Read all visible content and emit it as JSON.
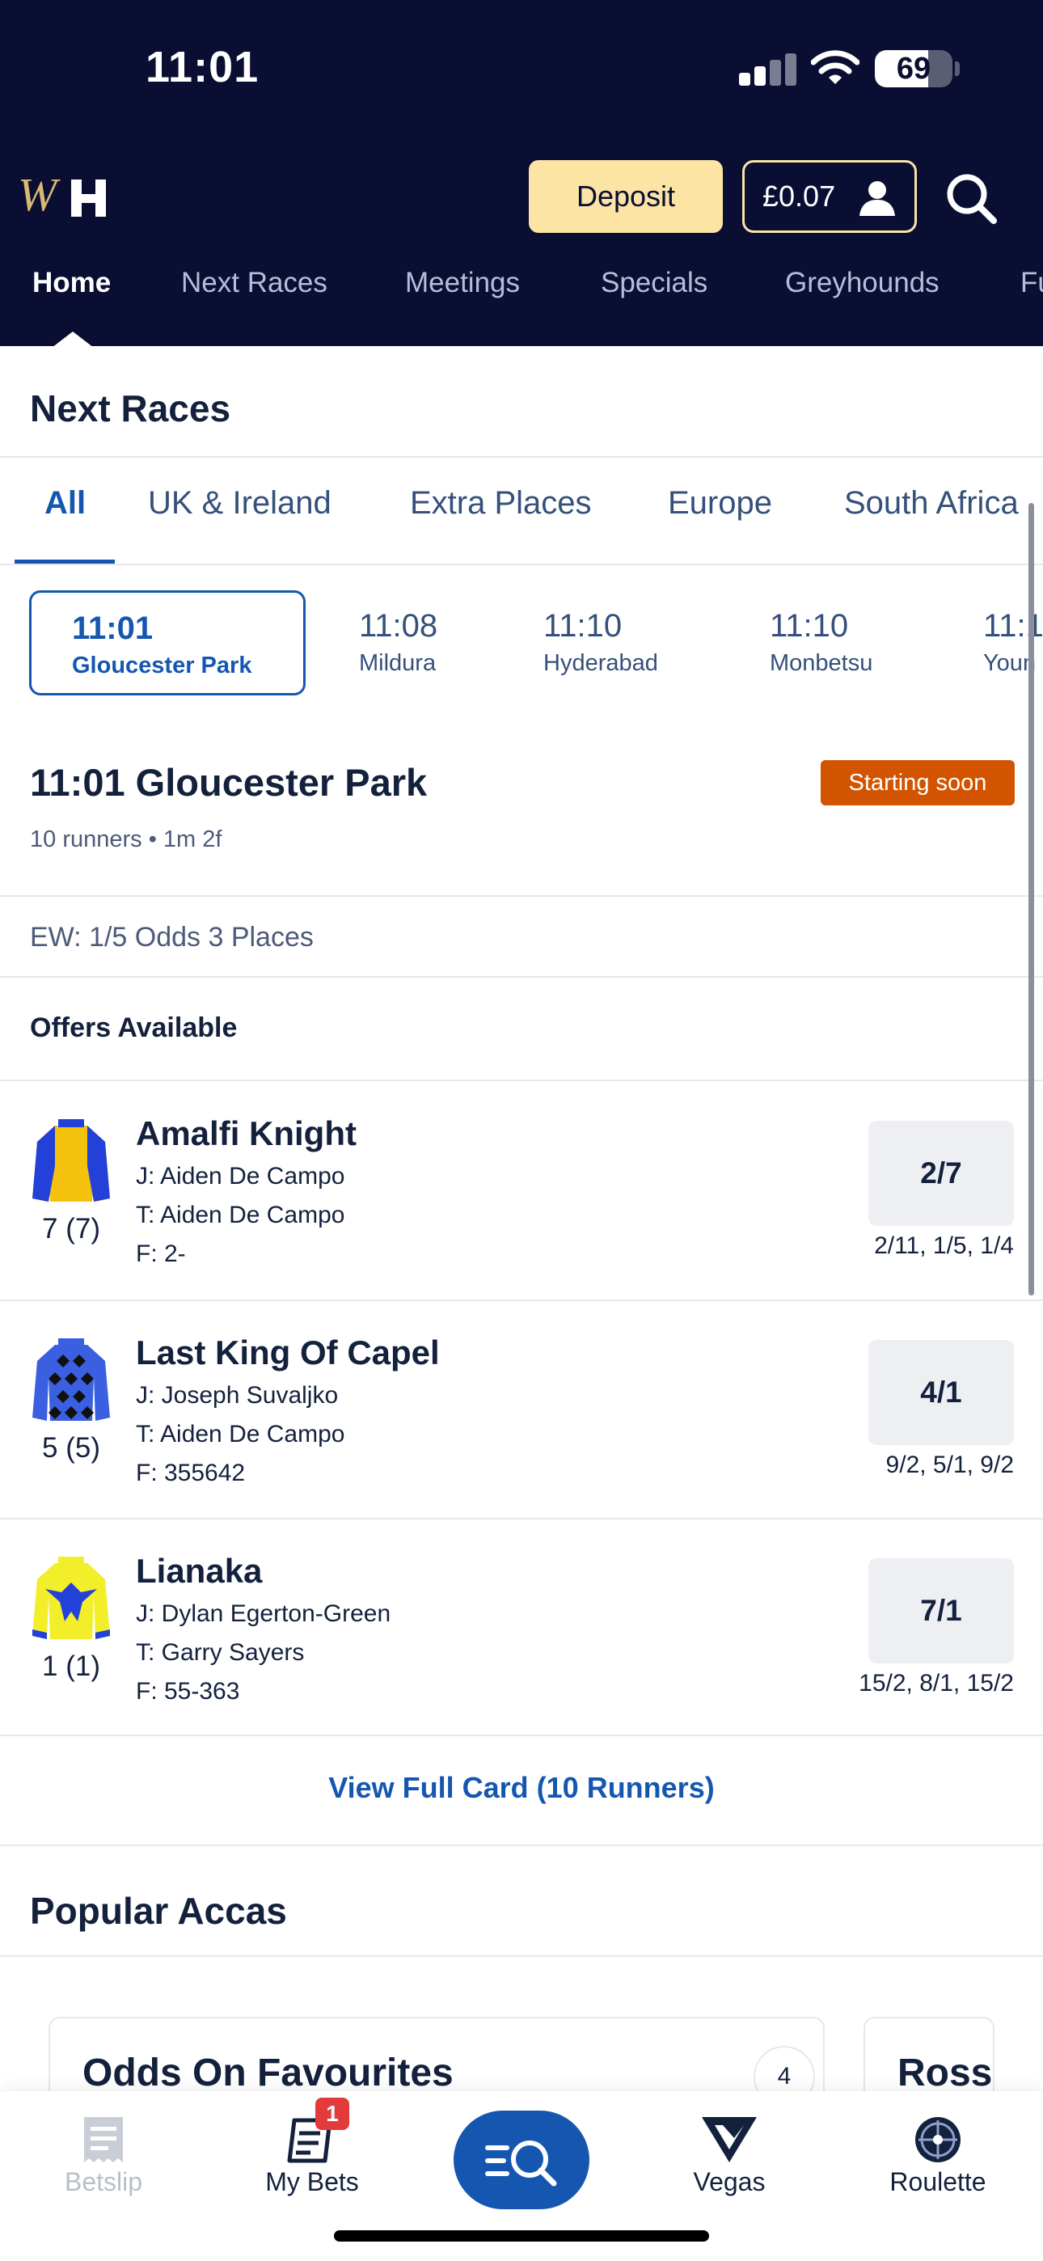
{
  "status_bar": {
    "time": "11:01",
    "battery": "69",
    "battery_level": 0.69
  },
  "header": {
    "deposit_label": "Deposit",
    "balance": "£0.07",
    "nav": [
      "Home",
      "Next Races",
      "Meetings",
      "Specials",
      "Greyhounds",
      "Fu"
    ]
  },
  "next_races": {
    "title": "Next Races",
    "filters": [
      "All",
      "UK & Ireland",
      "Extra Places",
      "Europe",
      "South Africa"
    ],
    "chips": [
      {
        "time": "11:01",
        "venue": "Gloucester Park"
      },
      {
        "time": "11:08",
        "venue": "Mildura"
      },
      {
        "time": "11:10",
        "venue": "Hyderabad"
      },
      {
        "time": "11:10",
        "venue": "Monbetsu"
      },
      {
        "time": "11:1",
        "venue": "Youn"
      }
    ]
  },
  "race": {
    "heading": "11:01 Gloucester Park",
    "meta": "10 runners • 1m 2f",
    "status": "Starting soon",
    "ew_terms": "EW: 1/5 Odds 3 Places",
    "offers": "Offers Available",
    "runners": [
      {
        "name": "Amalfi Knight",
        "jockey": "J: Aiden De Campo",
        "trainer": "T: Aiden De Campo",
        "form": "F: 2-",
        "number": "7 (7)",
        "odds": "2/7",
        "history": "2/11, 1/5, 1/4"
      },
      {
        "name": "Last King Of Capel",
        "jockey": "J: Joseph Suvaljko",
        "trainer": "T: Aiden De Campo",
        "form": "F: 355642",
        "number": "5 (5)",
        "odds": "4/1",
        "history": "9/2, 5/1, 9/2"
      },
      {
        "name": "Lianaka",
        "jockey": "J: Dylan Egerton-Green",
        "trainer": "T: Garry Sayers",
        "form": "F: 55-363",
        "number": "1 (1)",
        "odds": "7/1",
        "history": "15/2, 8/1, 15/2"
      }
    ],
    "view_full": "View Full Card (10 Runners)"
  },
  "popular_accas": {
    "title": "Popular Accas",
    "cards": [
      {
        "title": "Odds On Favourites",
        "count": "4"
      },
      {
        "title": "Rossa"
      }
    ]
  },
  "tab_bar": {
    "betslip": "Betslip",
    "my_bets": "My Bets",
    "my_bets_badge": "1",
    "vegas": "Vegas",
    "roulette": "Roulette"
  },
  "colors": {
    "navy": "#0a0e33",
    "gold": "#fbe4a4",
    "accent_blue": "#1557b0",
    "orange": "#d35400"
  }
}
